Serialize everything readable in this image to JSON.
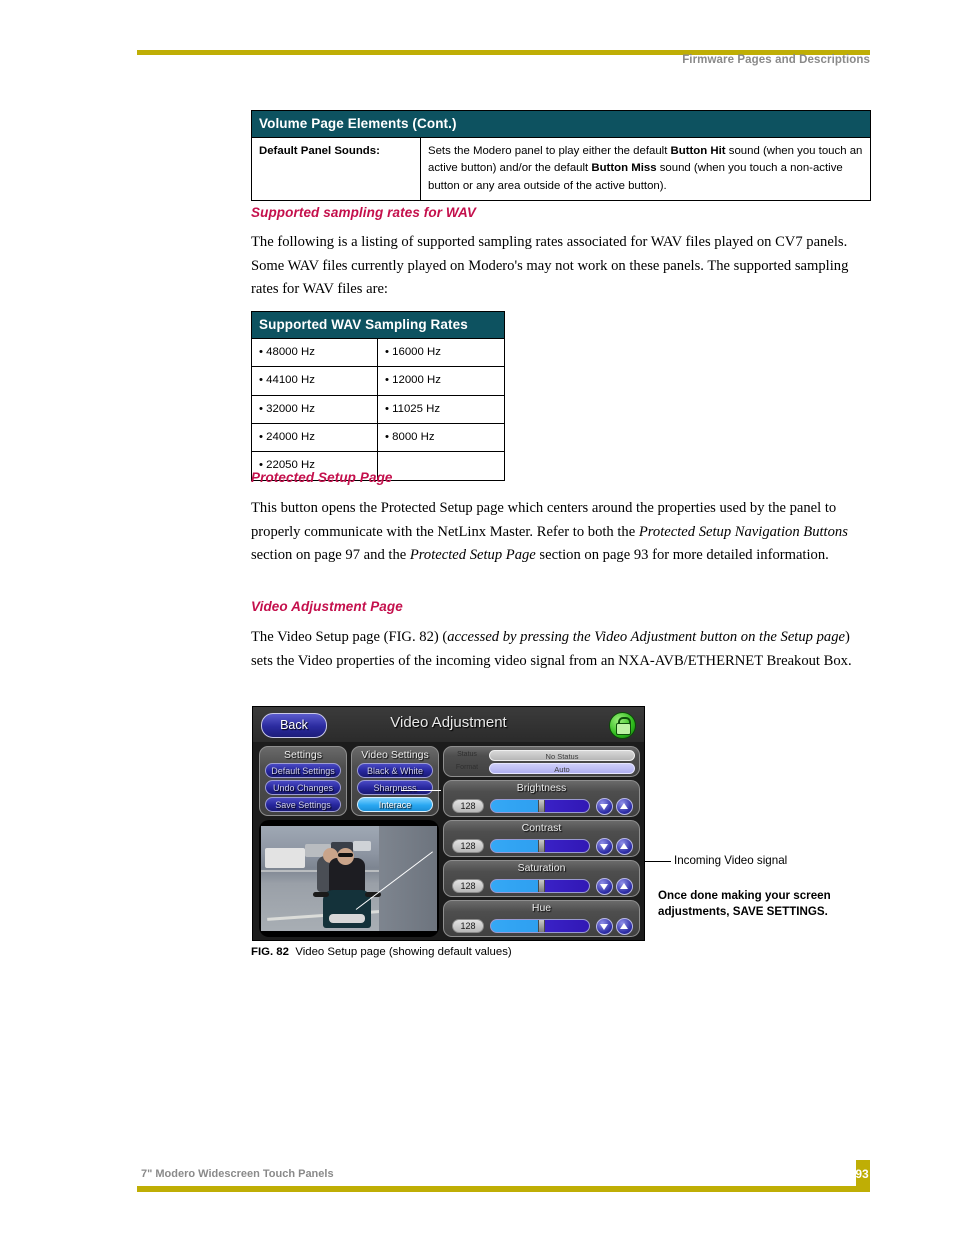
{
  "header": {
    "title": "Firmware Pages and Descriptions"
  },
  "footer": {
    "left": "7\" Modero Widescreen Touch Panels",
    "page": "93"
  },
  "volume_table": {
    "header": "Volume Page Elements (Cont.)",
    "rows": [
      {
        "label": "Default Panel Sounds:",
        "description_prefix": "Sets the Modero panel to play either the default ",
        "bold1": "Button Hit",
        "description_mid": " sound (when you touch an active button) and/or the default ",
        "bold2": "Button Miss",
        "description_suffix": " sound (when you touch a non-active button or any area outside of the active button)."
      }
    ]
  },
  "sampling_section": {
    "heading": "Supported sampling rates for WAV",
    "paragraph": "The following is a listing of supported sampling rates associated for WAV files played on CV7 panels. Some WAV files currently played on Modero's may not work on these panels. The supported sampling rates for WAV files are:"
  },
  "wav_table": {
    "header": "Supported WAV Sampling Rates",
    "rows": [
      [
        "• 48000 Hz",
        "• 16000 Hz"
      ],
      [
        "• 44100 Hz",
        "• 12000 Hz"
      ],
      [
        "• 32000 Hz",
        "• 11025 Hz"
      ],
      [
        "• 24000 Hz",
        "• 8000 Hz"
      ],
      [
        "• 22050 Hz",
        ""
      ]
    ]
  },
  "protected_section": {
    "heading": "Protected Setup Page",
    "p1": "This button opens the Protected Setup page which centers around the properties used by the panel to properly communicate with the NetLinx Master. Refer to both the ",
    "i1": "Protected Setup Navigation Buttons",
    "p2": " section on page 97 and the ",
    "i2": "Protected Setup Page",
    "p3": " section on page 93 for more detailed information."
  },
  "video_section": {
    "heading": "Video Adjustment Page",
    "p1": "The Video Setup page (FIG. 82) (",
    "i1": "accessed by pressing the Video Adjustment button on the Setup page",
    "p2": ") sets the Video properties of the incoming video signal from an NXA-AVB/ETHERNET Breakout Box."
  },
  "figure": {
    "caption_label": "FIG. 82",
    "caption_text": "Video Setup page (showing default values)",
    "callout_label": "Incoming Video signal",
    "note_line1": "Once done making your screen",
    "note_line2": "adjustments, SAVE SETTINGS."
  },
  "panel": {
    "back_button": "Back",
    "title": "Video Adjustment",
    "lock_icon": "lock-icon",
    "settings_group": {
      "title": "Settings",
      "buttons": [
        "Default Settings",
        "Undo Changes",
        "Save Settings"
      ]
    },
    "video_settings_group": {
      "title": "Video Settings",
      "buttons": [
        "Black & White",
        "Sharpness",
        "Interace"
      ],
      "active_button": "Interace"
    },
    "status": {
      "status_label": "Status",
      "status_value": "No Status",
      "format_label": "Format",
      "format_value": "Auto"
    },
    "sliders": [
      {
        "name": "Brightness",
        "value": "128"
      },
      {
        "name": "Contrast",
        "value": "128"
      },
      {
        "name": "Saturation",
        "value": "128"
      },
      {
        "name": "Hue",
        "value": "128"
      }
    ]
  },
  "colors": {
    "table_header_teal": "#0d5260",
    "heading_crimson": "#c4104c",
    "rule_olive": "#bfae05",
    "header_gray": "#8a8a8a"
  }
}
